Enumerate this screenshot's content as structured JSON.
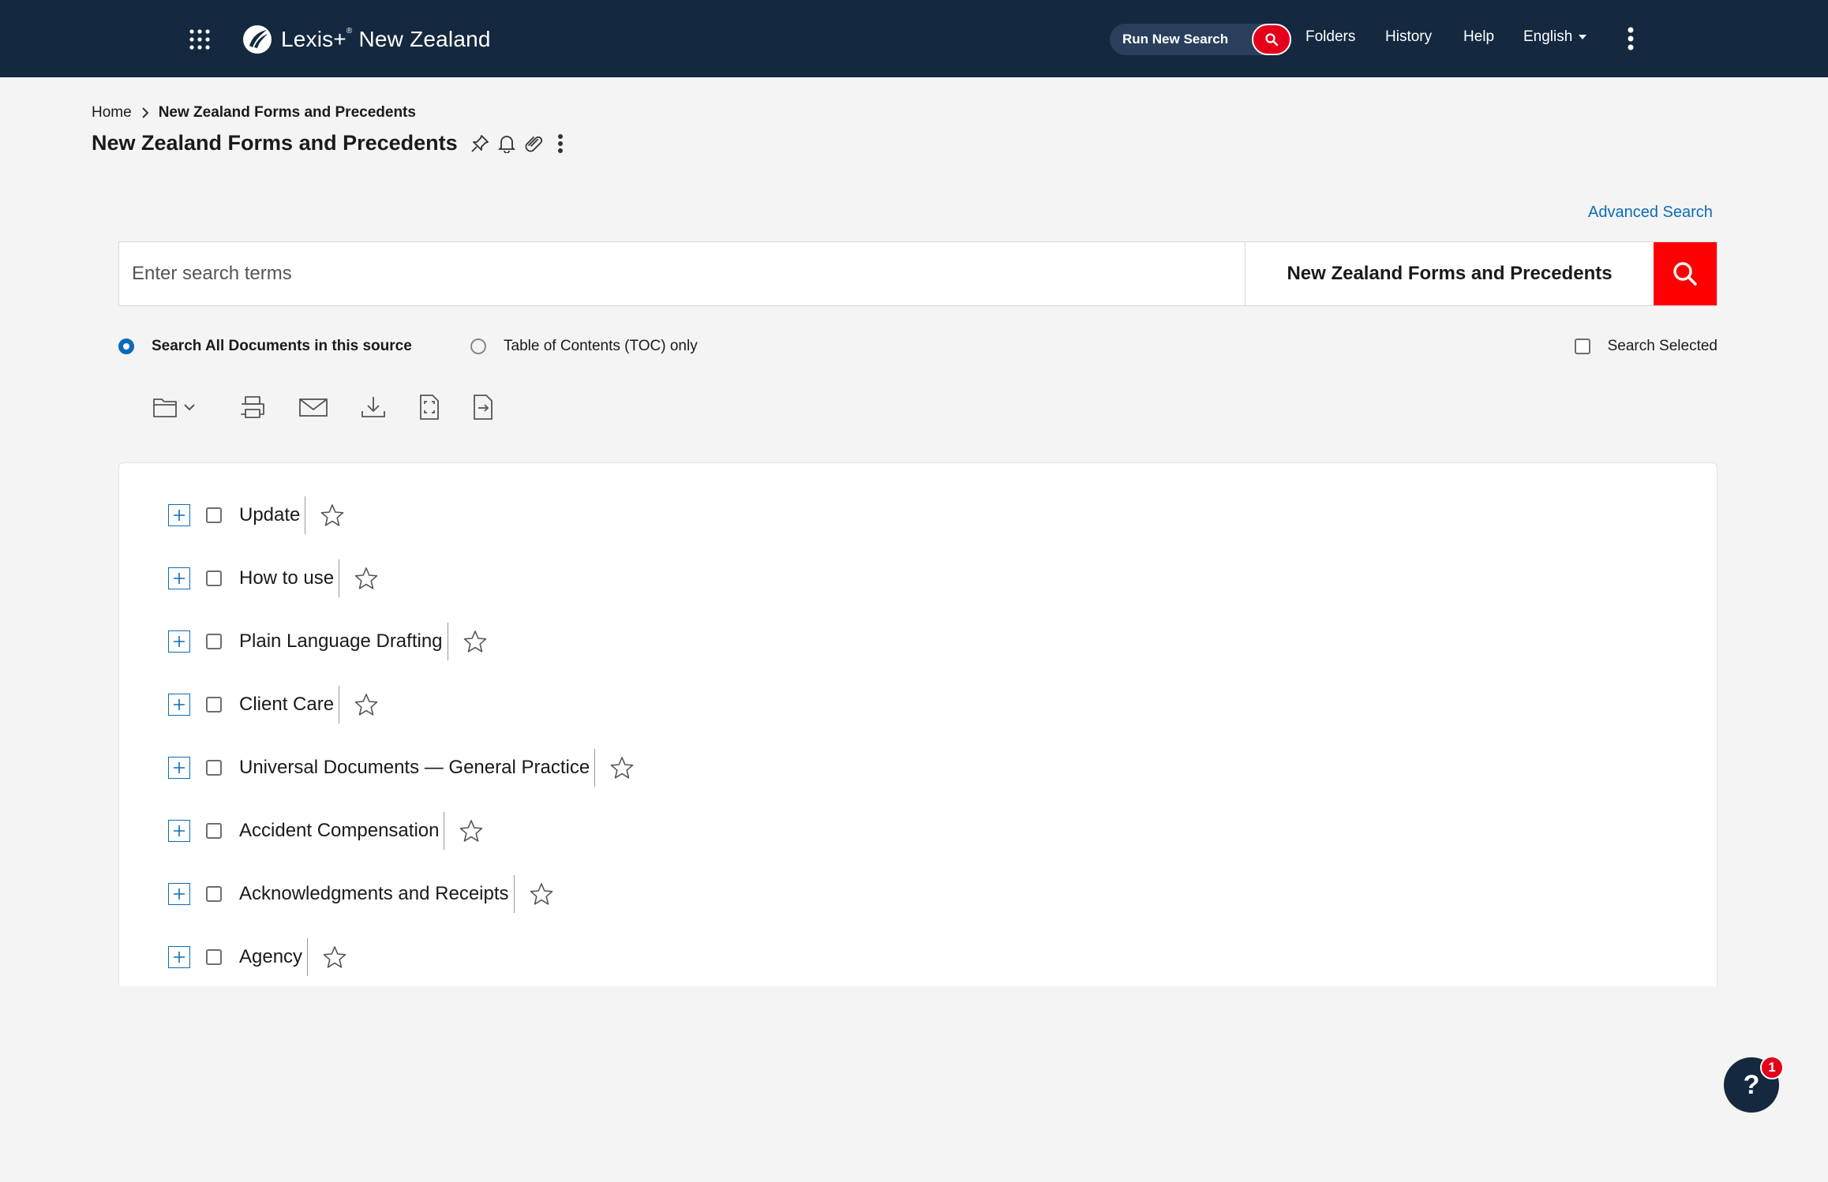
{
  "header": {
    "brand": "Lexis+",
    "brand_suffix": "New Zealand",
    "run_new_search": "Run New Search",
    "nav": [
      "Folders",
      "History",
      "Help"
    ],
    "language": "English",
    "colors": {
      "bar": "#14283f",
      "accent": "#e4001b"
    }
  },
  "breadcrumb": {
    "home": "Home",
    "current": "New Zealand Forms and Precedents"
  },
  "page_title": "New Zealand Forms and Precedents",
  "advanced_search": "Advanced Search",
  "search": {
    "placeholder": "Enter search terms",
    "source": "New Zealand Forms and Precedents"
  },
  "options": {
    "all_docs": "Search All Documents in this source",
    "toc_only": "Table of Contents (TOC) only",
    "search_selected": "Search Selected",
    "selected": "all_docs"
  },
  "toolbar": [
    "folder-icon",
    "print-icon",
    "email-icon",
    "download-icon",
    "full-doc-icon",
    "export-icon"
  ],
  "toc": [
    "Update",
    "How to use",
    "Plain Language Drafting",
    "Client Care",
    "Universal Documents — General Practice",
    "Accident Compensation",
    "Acknowledgments and Receipts",
    "Agency"
  ],
  "help": {
    "label": "?",
    "badge": "1"
  }
}
